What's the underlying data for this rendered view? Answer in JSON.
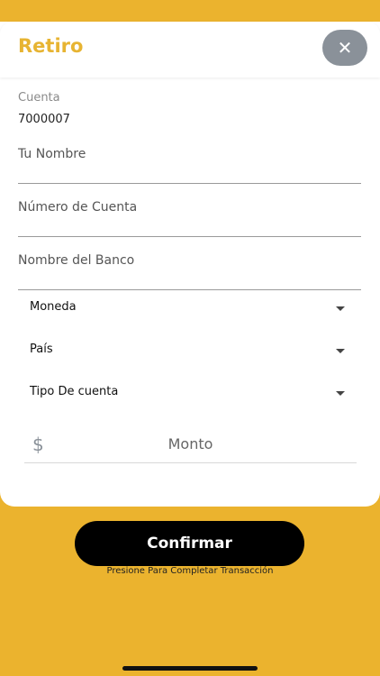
{
  "header": {
    "title": "Retiro",
    "close_icon": "close-icon"
  },
  "account": {
    "label": "Cuenta",
    "value": "7000007"
  },
  "fields": [
    {
      "label": "Tu Nombre"
    },
    {
      "label": "Número de Cuenta"
    },
    {
      "label": "Nombre del Banco"
    }
  ],
  "selects": [
    {
      "label": "Moneda"
    },
    {
      "label": "País"
    },
    {
      "label": "Tipo De cuenta"
    }
  ],
  "amount": {
    "symbol": "$",
    "placeholder": "Monto"
  },
  "confirm": {
    "label": "Confirmar",
    "hint": "Presione Para Completar Transacción"
  },
  "colors": {
    "background": "#ebb32e",
    "title": "#e7b432",
    "close_button": "#8a9199",
    "confirm_button": "#000000"
  }
}
